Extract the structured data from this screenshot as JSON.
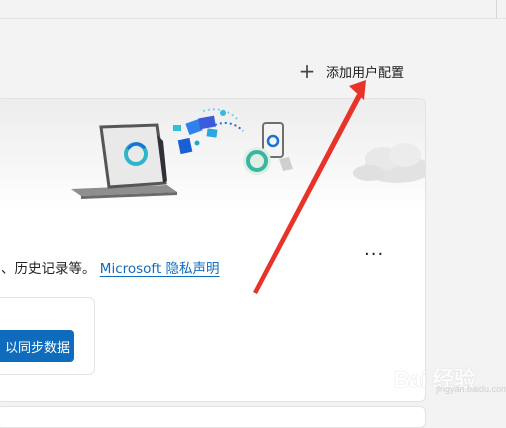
{
  "header": {
    "add_profile_label": "添加用户配置"
  },
  "sync_card": {
    "description": "、历史记录等。",
    "privacy_link": "Microsoft 隐私声明",
    "more_menu": "...",
    "sync_button_label": "以同步数据"
  },
  "watermark": {
    "brand": "Bai 经验",
    "url": "jingyan.baidu.com"
  },
  "colors": {
    "accent": "#0f6cbd",
    "annotation_arrow": "#e8332a"
  },
  "icons": [
    "plus-icon",
    "more-options-icon",
    "laptop-illustration",
    "phone-illustration",
    "cloud-illustration"
  ]
}
